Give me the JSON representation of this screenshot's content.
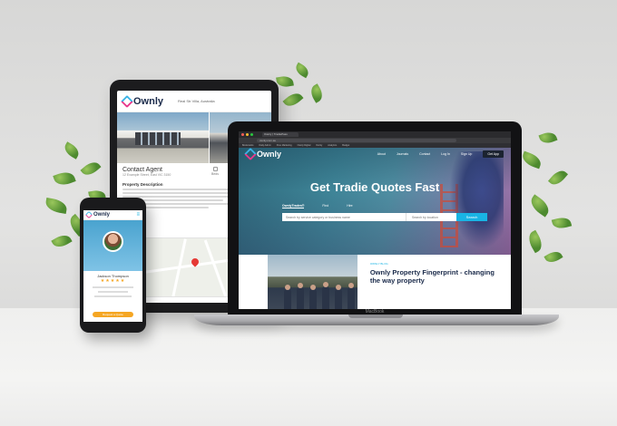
{
  "tablet": {
    "brand": "Ownly",
    "header_location": "Real Str Villa, Australia",
    "agent_title": "Contact Agent",
    "agent_address": "12 Example Street, East VIC 3150",
    "stats": [
      {
        "value": "Beds"
      },
      {
        "value": "Baths"
      },
      {
        "value": "Cars"
      }
    ],
    "description_title": "Property Description"
  },
  "laptop": {
    "tab_title": "Ownly | TradiePass",
    "url": "ownly.com.au",
    "bookmarks": [
      "Bookmarks",
      "Daily Admin",
      "Pure Marketing",
      "Ownly Digital",
      "Ownly",
      "Analytics",
      "Budget"
    ],
    "brand": "Ownly",
    "nav": [
      "About",
      "Journals",
      "Contact",
      "Log In",
      "Sign Up"
    ],
    "nav_cta": "Get App",
    "hero_title": "Get Tradie Quotes Fast",
    "tabs": [
      "OwnlyTrades®",
      "Find",
      "Hire"
    ],
    "search_placeholder": "Search by service category or business name",
    "location_placeholder": "Search by location",
    "search_button": "Search",
    "article_kicker": "OWNLY BLOG",
    "article_title": "Ownly Property Fingerprint - changing the way property",
    "device_brand": "MacBook"
  },
  "phone": {
    "brand": "Ownly",
    "menu_icon": "≡",
    "profile_name": "Jackson Thompson",
    "stars": "★★★★★",
    "cta": "Request a Quote"
  }
}
